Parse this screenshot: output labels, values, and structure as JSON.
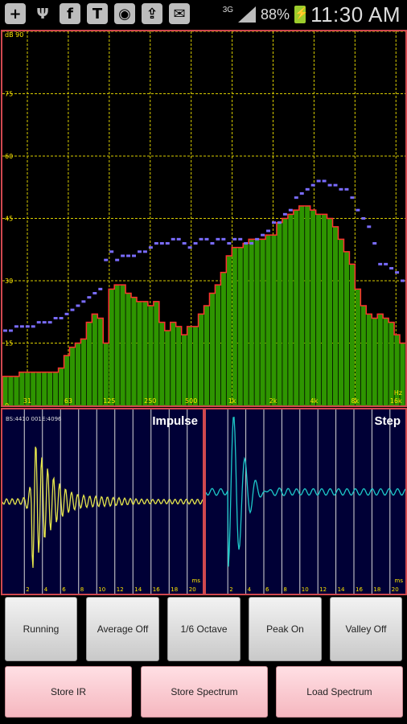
{
  "status_bar": {
    "notification_icons": [
      "plus-icon",
      "usb-icon",
      "facebook-icon",
      "text-icon",
      "instagram-icon",
      "cloud-upload-icon",
      "email-icon"
    ],
    "network": "3G",
    "battery": "88%",
    "time": "11:30 AM"
  },
  "spectrum": {
    "y_ticks": [
      "dB 90",
      "75",
      "60",
      "45",
      "30",
      "15",
      "0"
    ],
    "x_ticks": [
      "31",
      "63",
      "125",
      "250",
      "500",
      "1k",
      "2k",
      "4k",
      "8k",
      "16k"
    ],
    "x_unit": "Hz",
    "colors": {
      "bars": "#2e9500",
      "outline": "#ff3030",
      "peaks": "#7a6cff",
      "grid": "#d8cc00"
    },
    "chart_data": {
      "type": "bar",
      "title": "",
      "xlabel": "Hz",
      "ylabel": "dB",
      "ylim": [
        0,
        90
      ],
      "x_scale": "log",
      "xlim": [
        20,
        20000
      ],
      "grid": true,
      "series": [
        {
          "values": [
            7,
            7,
            7,
            8,
            8,
            8,
            8,
            8,
            8,
            8,
            9,
            12,
            14,
            15,
            16,
            20,
            22,
            21,
            15,
            28,
            29,
            29,
            27,
            26,
            25,
            25,
            24,
            25,
            20,
            18,
            20,
            19,
            17,
            19,
            19,
            22,
            24,
            27,
            29,
            32,
            36,
            38,
            38,
            39,
            40,
            40,
            40,
            41,
            41,
            44,
            45,
            46,
            47,
            48,
            48,
            47,
            46,
            46,
            45,
            43,
            40,
            37,
            34,
            28,
            24,
            22,
            21,
            22,
            21,
            20,
            17,
            15
          ]
        },
        {
          "values": [
            18,
            18,
            19,
            19,
            19,
            19,
            20,
            20,
            20,
            21,
            21,
            22,
            23,
            24,
            25,
            26,
            27,
            28,
            35,
            37,
            35,
            36,
            36,
            36,
            37,
            37,
            38,
            39,
            39,
            39,
            40,
            40,
            39,
            38,
            39,
            40,
            40,
            39,
            40,
            40,
            39,
            40,
            40,
            39,
            39,
            40,
            41,
            42,
            44,
            44,
            46,
            47,
            50,
            51,
            52,
            53,
            54,
            54,
            53,
            53,
            52,
            52,
            50,
            47,
            45,
            43,
            39,
            34,
            34,
            33,
            32,
            30
          ]
        }
      ]
    }
  },
  "impulse": {
    "title": "Impulse",
    "readout": "BS:4410 001E:4096",
    "x_ticks": [
      "2",
      "4",
      "6",
      "8",
      "10",
      "12",
      "14",
      "16",
      "18",
      "20"
    ],
    "x_unit": "ms",
    "trace_color": "#e6e64c"
  },
  "step": {
    "title": "Step",
    "x_ticks": [
      "2",
      "4",
      "6",
      "8",
      "10",
      "12",
      "14",
      "16",
      "18",
      "20"
    ],
    "x_unit": "ms",
    "trace_color": "#1dc8c8"
  },
  "buttons": {
    "running": "Running",
    "average": "Average Off",
    "octave": "1/6 Octave",
    "peak": "Peak On",
    "valley": "Valley Off",
    "store_ir": "Store IR",
    "store_spectrum": "Store Spectrum",
    "load_spectrum": "Load Spectrum"
  }
}
